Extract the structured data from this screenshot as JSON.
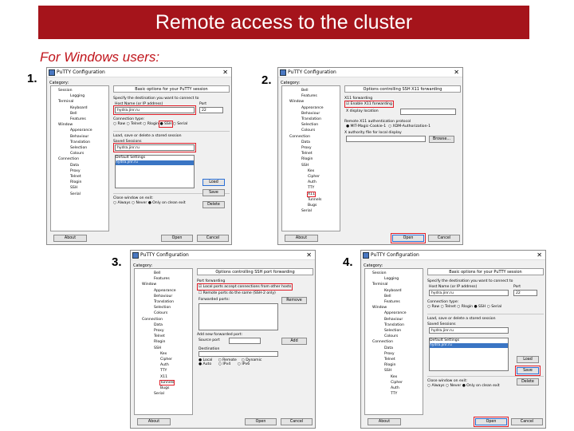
{
  "slide": {
    "title": "Remote access to the cluster",
    "subtitle": "For Windows users:",
    "step_numbers": [
      "1.",
      "2.",
      "3.",
      "4."
    ],
    "accent_color": "#a5141b",
    "highlight_color": "#e0202a"
  },
  "window_title": "PuTTY Configuration",
  "category_label": "Category:",
  "buttons": {
    "about": "About",
    "open": "Open",
    "cancel": "Cancel",
    "load": "Load",
    "save": "Save",
    "delete": "Delete",
    "browse": "Browse...",
    "add": "Add",
    "remove": "Remove"
  },
  "win1": {
    "tree": [
      "Session",
      "Logging",
      "Terminal",
      "Keyboard",
      "Bell",
      "Features",
      "Window",
      "Appearance",
      "Behaviour",
      "Translation",
      "Selection",
      "Colours",
      "Connection",
      "Data",
      "Proxy",
      "Telnet",
      "Rlogin",
      "SSH",
      "Serial"
    ],
    "header": "Basic options for your PuTTY session",
    "dest_label": "Specify the destination you want to connect to",
    "host_label": "Host Name (or IP address)",
    "port_label": "Port",
    "host_value": "hydra.jinr.ru",
    "port_value": "22",
    "conn_type_label": "Connection type:",
    "conn_types": [
      "Raw",
      "Telnet",
      "Rlogin",
      "SSH",
      "Serial"
    ],
    "load_label": "Load, save or delete a stored session",
    "saved_label": "Saved Sessions",
    "saved_value": "hydra.jinr.ru",
    "sessions": [
      "Default Settings",
      "hydra.jinr.ru"
    ],
    "close_label": "Close window on exit:",
    "close_opts": [
      "Always",
      "Never",
      "Only on clean exit"
    ]
  },
  "win2": {
    "tree": [
      "Bell",
      "Features",
      "Window",
      "Appearance",
      "Behaviour",
      "Translation",
      "Selection",
      "Colours",
      "Connection",
      "Data",
      "Proxy",
      "Telnet",
      "Rlogin",
      "SSH",
      "Kex",
      "Cipher",
      "Auth",
      "TTY",
      "X11",
      "Tunnels",
      "Bugs",
      "Serial"
    ],
    "header": "Options controlling SSH X11 forwarding",
    "x11_label": "X11 forwarding",
    "enable_x11": "Enable X11 forwarding",
    "display_label": "X display location",
    "auth_label": "Remote X11 authentication protocol",
    "auth_opts": [
      "MIT-Magic-Cookie-1",
      "XDM-Authorization-1"
    ],
    "xauth_label": "X authority file for local display"
  },
  "win3": {
    "tree": [
      "Bell",
      "Features",
      "Window",
      "Appearance",
      "Behaviour",
      "Translation",
      "Selection",
      "Colours",
      "Connection",
      "Data",
      "Proxy",
      "Telnet",
      "Rlogin",
      "SSH",
      "Kex",
      "Cipher",
      "Auth",
      "TTY",
      "X11",
      "Tunnels",
      "Bugs",
      "Serial"
    ],
    "header": "Options controlling SSH port forwarding",
    "port_fwd_label": "Port forwarding",
    "local_ports": "Local ports accept connections from other hosts",
    "remote_ports": "Remote ports do the same (SSH-2 only)",
    "forwarded_label": "Forwarded ports:",
    "add_new_label": "Add new forwarded port:",
    "source_port": "Source port",
    "destination": "Destination",
    "dir_opts": [
      "Local",
      "Remote",
      "Dynamic"
    ],
    "ip_opts": [
      "Auto",
      "IPv4",
      "IPv6"
    ]
  },
  "win4": {
    "tree": [
      "Session",
      "Logging",
      "Terminal",
      "Keyboard",
      "Bell",
      "Features",
      "Window",
      "Appearance",
      "Behaviour",
      "Translation",
      "Selection",
      "Colours",
      "Connection",
      "Data",
      "Proxy",
      "Telnet",
      "Rlogin",
      "SSH",
      "Kex",
      "Cipher",
      "Auth",
      "TTY"
    ],
    "header": "Basic options for your PuTTY session",
    "saved_value": "hydra.jinr.ru"
  }
}
